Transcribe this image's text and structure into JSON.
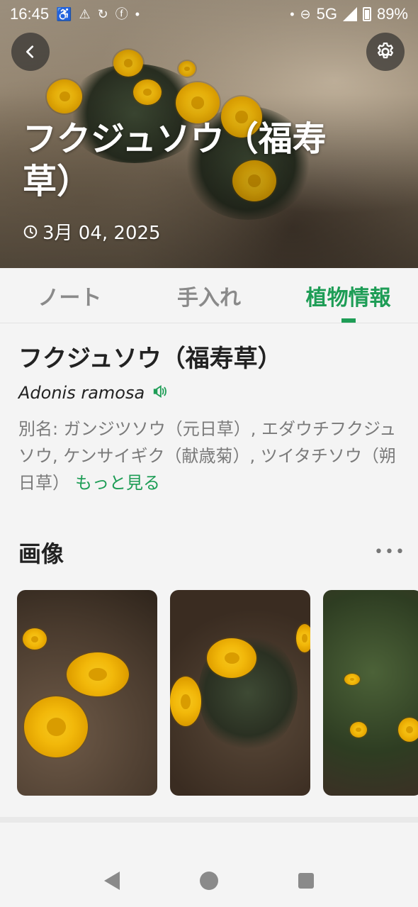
{
  "status_bar": {
    "time": "16:45",
    "network": "5G",
    "battery": "89%",
    "icons": [
      "accessibility-icon",
      "warning-icon",
      "sync-icon",
      "facebook-icon",
      "dot-icon",
      "dot-icon",
      "do-not-disturb-icon",
      "signal-icon",
      "battery-icon"
    ]
  },
  "hero": {
    "title": "フクジュソウ（福寿草）",
    "date": "3月 04, 2025",
    "back_icon": "chevron-left-icon",
    "settings_icon": "gear-icon"
  },
  "tabs": [
    {
      "label": "ノート",
      "active": false
    },
    {
      "label": "手入れ",
      "active": false
    },
    {
      "label": "植物情報",
      "active": true
    }
  ],
  "plant": {
    "name": "フクジュソウ（福寿草）",
    "scientific_name": "Adonis ramosa",
    "aliases": "別名: ガンジツソウ（元日草）, エダウチフクジュソウ, ケンサイギク（献歳菊）, ツイタチソウ（朔日草）",
    "more_label": "もっと見る"
  },
  "images": {
    "header": "画像",
    "more_icon": "more-horizontal-icon",
    "count_visible": 3
  },
  "colors": {
    "accent": "#1e9d56",
    "background": "#f4f4f4",
    "muted_text": "#7a7a7a"
  }
}
